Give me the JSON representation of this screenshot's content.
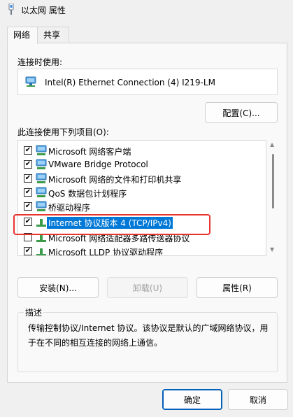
{
  "window": {
    "title": "以太网 属性",
    "icon": "network-adapter-pin-icon"
  },
  "tabs": [
    {
      "label": "网络",
      "active": true
    },
    {
      "label": "共享",
      "active": false
    }
  ],
  "connect_using": {
    "label": "连接时使用:",
    "adapter_name": "Intel(R) Ethernet Connection (4) I219-LM",
    "configure_button": "配置(C)..."
  },
  "items_section": {
    "label": "此连接使用下列项目(O):",
    "items": [
      {
        "label": "Microsoft 网络客户端",
        "checked": true,
        "icon": "network-client-icon",
        "selected": false
      },
      {
        "label": "VMware Bridge Protocol",
        "checked": true,
        "icon": "network-service-icon",
        "selected": false
      },
      {
        "label": "Microsoft 网络的文件和打印机共享",
        "checked": true,
        "icon": "network-service-icon",
        "selected": false
      },
      {
        "label": "QoS 数据包计划程序",
        "checked": true,
        "icon": "network-service-icon",
        "selected": false
      },
      {
        "label": "桥驱动程序",
        "checked": true,
        "icon": "network-service-icon",
        "selected": false
      },
      {
        "label": "Internet 协议版本 4 (TCP/IPv4)",
        "checked": true,
        "icon": "protocol-icon",
        "selected": true
      },
      {
        "label": "Microsoft 网络适配器多路传送器协议",
        "checked": false,
        "icon": "protocol-icon",
        "selected": false
      },
      {
        "label": "Microsoft LLDP 协议驱动程序",
        "checked": true,
        "icon": "protocol-icon",
        "selected": false
      }
    ]
  },
  "action_buttons": {
    "install": "安装(N)...",
    "uninstall": "卸载(U)",
    "properties": "属性(R)"
  },
  "description": {
    "legend": "描述",
    "text": "传输控制协议/Internet 协议。该协议是默认的广域网络协议，用于在不同的相互连接的网络上通信。"
  },
  "footer": {
    "ok": "确定",
    "cancel": "取消"
  },
  "colors": {
    "selection": "#0078d7",
    "highlight_outline": "#e8332f",
    "accent": "#005fb8"
  }
}
